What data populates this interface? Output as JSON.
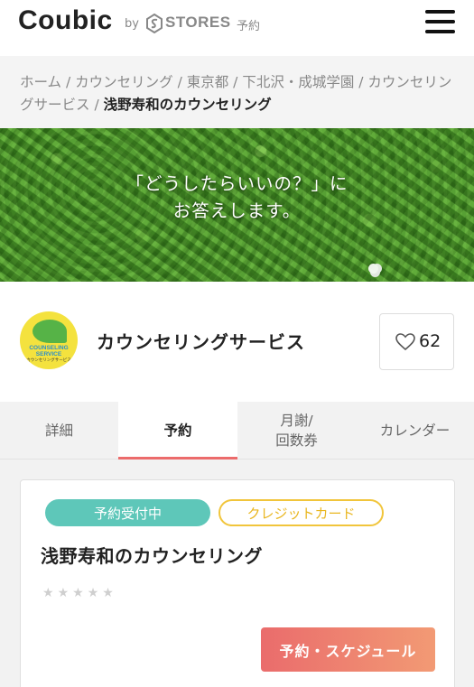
{
  "header": {
    "logo": "Coubic",
    "by": "by",
    "stores": "STORES",
    "stores_suffix": "予約"
  },
  "breadcrumb": {
    "items": [
      "ホーム",
      "カウンセリング",
      "東京都",
      "下北沢・成城学園",
      "カウンセリングサービス"
    ],
    "separator": " / ",
    "current": "浅野寿和のカウンセリング"
  },
  "hero": {
    "line1": "「どうしたらいいの？」に",
    "line2": "お答えします。"
  },
  "shop": {
    "logo_text_1": "COUNSELING",
    "logo_text_2": "SERVICE",
    "logo_text_3": "カウンセリングサービス",
    "name": "カウンセリングサービス",
    "favorite_count": "62"
  },
  "tabs": [
    {
      "label": "詳細",
      "active": false
    },
    {
      "label": "予約",
      "active": true
    },
    {
      "label": "月謝/\n回数券",
      "active": false
    },
    {
      "label": "カレンダー",
      "active": false
    }
  ],
  "card": {
    "badge_status": "予約受付中",
    "badge_payment": "クレジットカード",
    "title": "浅野寿和のカウンセリング",
    "rating_stars": 0,
    "rating_max": 5,
    "reserve_button": "予約・スケジュール"
  },
  "colors": {
    "accent": "#ec6b6b",
    "badge_green": "#5ec7b9",
    "badge_yellow": "#f1c53b"
  }
}
